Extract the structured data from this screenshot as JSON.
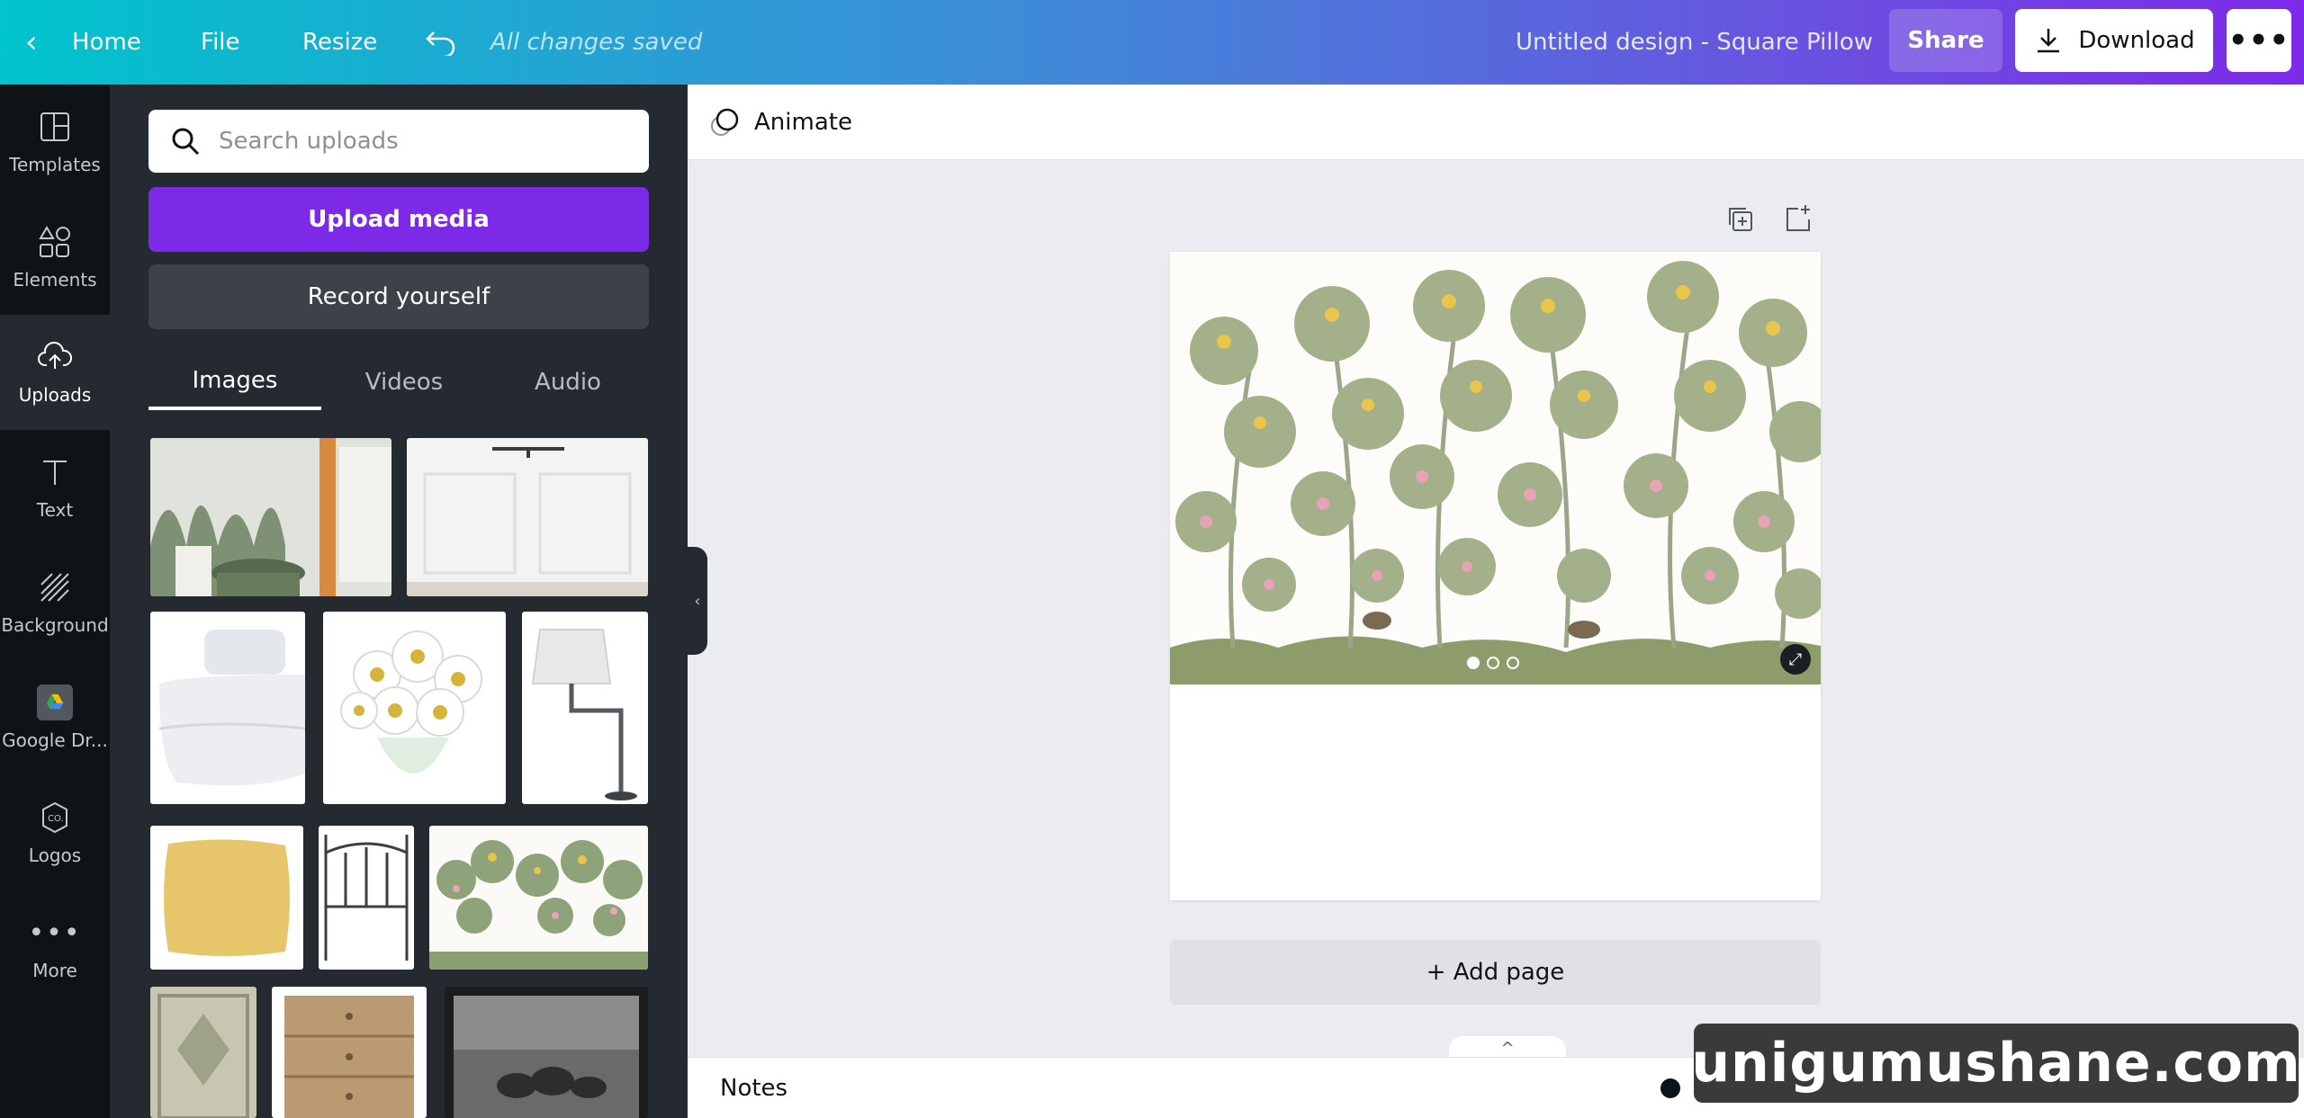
{
  "topbar": {
    "home": "Home",
    "file": "File",
    "resize": "Resize",
    "saved": "All changes saved",
    "title": "Untitled design - Square Pillow",
    "share": "Share",
    "download": "Download"
  },
  "rail": [
    {
      "label": "Templates",
      "icon": "templates-icon"
    },
    {
      "label": "Elements",
      "icon": "elements-icon"
    },
    {
      "label": "Uploads",
      "icon": "upload-cloud-icon"
    },
    {
      "label": "Text",
      "icon": "text-icon"
    },
    {
      "label": "Background",
      "icon": "background-icon"
    },
    {
      "label": "Google Dr...",
      "icon": "google-drive-icon"
    },
    {
      "label": "Logos",
      "icon": "logos-icon"
    },
    {
      "label": "More",
      "icon": "more-icon"
    }
  ],
  "panel": {
    "search_placeholder": "Search uploads",
    "upload_button": "Upload media",
    "record_button": "Record yourself",
    "tabs": [
      "Images",
      "Videos",
      "Audio"
    ]
  },
  "toolbar": {
    "animate": "Animate"
  },
  "canvas": {
    "add_page": "+ Add page"
  },
  "bottom": {
    "notes": "Notes"
  },
  "watermark": "unigumushane.com",
  "colors": {
    "accent": "#7d2ae8",
    "brand_teal": "#00c4cc"
  }
}
